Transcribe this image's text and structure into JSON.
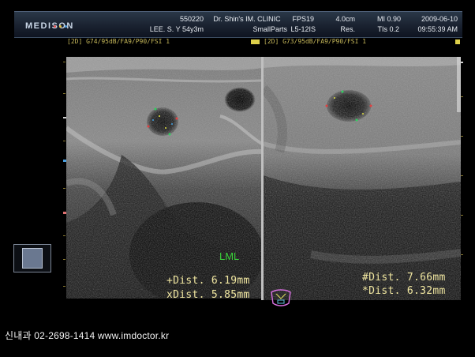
{
  "header": {
    "brand": "MEDISON",
    "id": "550220",
    "patient": "LEE. S. Y 54y3m",
    "clinic": "Dr. Shin's IM. CLINIC",
    "preset": "SmallParts",
    "fps": "FPS19",
    "probe": "L5-12IS",
    "depth": "4.0cm",
    "res": "Res.",
    "mi": "MI 0.90",
    "tis": "TIs 0.2",
    "date": "2009-06-10",
    "time": "09:55:39 AM"
  },
  "left_pane": {
    "probe_info": "[2D] G74/95dB/FA9/P90/FSI 1",
    "label": "LML",
    "measurements": [
      "+Dist. 6.19mm",
      "xDist. 5.85mm"
    ]
  },
  "right_pane": {
    "probe_info": "[2D] G73/95dB/FA9/P90/FSI 1",
    "measurements": [
      "#Dist. 7.66mm",
      "*Dist. 6.32mm"
    ]
  },
  "footer": "신내과 02-2698-1414  www.imdoctor.kr",
  "colors": {
    "header_bg": "#1a2230",
    "measurement": "#f0e6a0",
    "probe_info": "#c6b85a",
    "label_green": "#3ad03a"
  }
}
